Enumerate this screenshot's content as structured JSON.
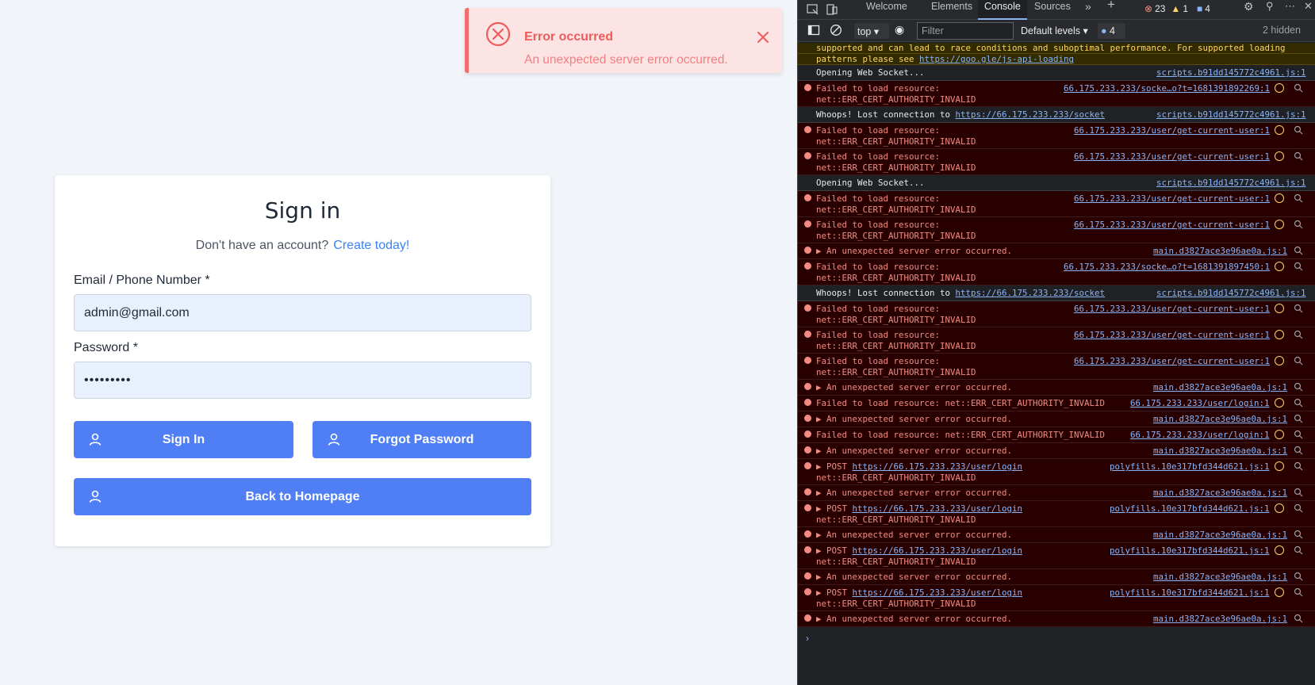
{
  "toast": {
    "title": "Error occurred",
    "message": "An unexpected server error occurred."
  },
  "signin": {
    "title": "Sign in",
    "no_account": "Don't have an account?",
    "create_link": "Create today!",
    "email_label": "Email / Phone Number *",
    "email_value": "admin@gmail.com",
    "password_label": "Password *",
    "password_value": "•••••••••",
    "signin_button": "Sign In",
    "forgot_button": "Forgot Password",
    "home_button": "Back to Homepage"
  },
  "devtools": {
    "tabs": [
      "Welcome",
      "Elements",
      "Console",
      "Sources"
    ],
    "errors_count": "23",
    "warnings_count": "1",
    "messages_count": "4",
    "context": "top",
    "filter_placeholder": "Filter",
    "levels": "Default levels",
    "msg_badge": "4",
    "hidden": "2 hidden",
    "rows": [
      {
        "type": "warn",
        "msg": "supported and can lead to race conditions and suboptimal performance. For supported loading",
        "src": ""
      },
      {
        "type": "warn",
        "msg": "patterns please see ",
        "link": "https://goo.gle/js-api-loading",
        "src": ""
      },
      {
        "type": "log",
        "msg": "Opening Web Socket...",
        "src": "scripts.b91dd145772c4961.js:1"
      },
      {
        "type": "error",
        "msg": "Failed to load resource:\nnet::ERR_CERT_AUTHORITY_INVALID",
        "src": "66.175.233.233/socke…o?t=1681391892269:1"
      },
      {
        "type": "log",
        "msg": "Whoops! Lost connection to ",
        "link": "https://66.175.233.233/socket",
        "src": "scripts.b91dd145772c4961.js:1"
      },
      {
        "type": "error",
        "msg": "Failed to load resource:\nnet::ERR_CERT_AUTHORITY_INVALID",
        "src": "66.175.233.233/user/get-current-user:1"
      },
      {
        "type": "error",
        "msg": "Failed to load resource:\nnet::ERR_CERT_AUTHORITY_INVALID",
        "src": "66.175.233.233/user/get-current-user:1"
      },
      {
        "type": "log",
        "msg": "Opening Web Socket...",
        "src": "scripts.b91dd145772c4961.js:1"
      },
      {
        "type": "error",
        "msg": "Failed to load resource:\nnet::ERR_CERT_AUTHORITY_INVALID",
        "src": "66.175.233.233/user/get-current-user:1"
      },
      {
        "type": "error",
        "msg": "Failed to load resource:\nnet::ERR_CERT_AUTHORITY_INVALID",
        "src": "66.175.233.233/user/get-current-user:1"
      },
      {
        "type": "error",
        "msg": "▶ An unexpected server error occurred.",
        "src": "main.d3827ace3e96ae0a.js:1"
      },
      {
        "type": "error",
        "msg": "Failed to load resource:\nnet::ERR_CERT_AUTHORITY_INVALID",
        "src": "66.175.233.233/socke…o?t=1681391897450:1"
      },
      {
        "type": "log",
        "msg": "Whoops! Lost connection to ",
        "link": "https://66.175.233.233/socket",
        "src": "scripts.b91dd145772c4961.js:1"
      },
      {
        "type": "error",
        "msg": "Failed to load resource:\nnet::ERR_CERT_AUTHORITY_INVALID",
        "src": "66.175.233.233/user/get-current-user:1"
      },
      {
        "type": "error",
        "msg": "Failed to load resource:\nnet::ERR_CERT_AUTHORITY_INVALID",
        "src": "66.175.233.233/user/get-current-user:1"
      },
      {
        "type": "error",
        "msg": "Failed to load resource:\nnet::ERR_CERT_AUTHORITY_INVALID",
        "src": "66.175.233.233/user/get-current-user:1"
      },
      {
        "type": "error",
        "msg": "▶ An unexpected server error occurred.",
        "src": "main.d3827ace3e96ae0a.js:1"
      },
      {
        "type": "error",
        "msg": "Failed to load resource: net::ERR_CERT_AUTHORITY_INVALID",
        "src": "66.175.233.233/user/login:1"
      },
      {
        "type": "error",
        "msg": "▶ An unexpected server error occurred.",
        "src": "main.d3827ace3e96ae0a.js:1"
      },
      {
        "type": "error",
        "msg": "Failed to load resource: net::ERR_CERT_AUTHORITY_INVALID",
        "src": "66.175.233.233/user/login:1"
      },
      {
        "type": "error",
        "msg": "▶ An unexpected server error occurred.",
        "src": "main.d3827ace3e96ae0a.js:1"
      },
      {
        "type": "error",
        "msg": "▶ POST ",
        "link": "https://66.175.233.233/user/login",
        "msg2": "\nnet::ERR_CERT_AUTHORITY_INVALID",
        "src": "polyfills.10e317bfd344d621.js:1"
      },
      {
        "type": "error",
        "msg": "▶ An unexpected server error occurred.",
        "src": "main.d3827ace3e96ae0a.js:1"
      },
      {
        "type": "error",
        "msg": "▶ POST ",
        "link": "https://66.175.233.233/user/login",
        "msg2": "\nnet::ERR_CERT_AUTHORITY_INVALID",
        "src": "polyfills.10e317bfd344d621.js:1"
      },
      {
        "type": "error",
        "msg": "▶ An unexpected server error occurred.",
        "src": "main.d3827ace3e96ae0a.js:1"
      },
      {
        "type": "error",
        "msg": "▶ POST ",
        "link": "https://66.175.233.233/user/login",
        "msg2": "\nnet::ERR_CERT_AUTHORITY_INVALID",
        "src": "polyfills.10e317bfd344d621.js:1"
      },
      {
        "type": "error",
        "msg": "▶ An unexpected server error occurred.",
        "src": "main.d3827ace3e96ae0a.js:1"
      },
      {
        "type": "error",
        "msg": "▶ POST ",
        "link": "https://66.175.233.233/user/login",
        "msg2": "\nnet::ERR_CERT_AUTHORITY_INVALID",
        "src": "polyfills.10e317bfd344d621.js:1"
      },
      {
        "type": "error",
        "msg": "▶ An unexpected server error occurred.",
        "src": "main.d3827ace3e96ae0a.js:1"
      }
    ]
  }
}
